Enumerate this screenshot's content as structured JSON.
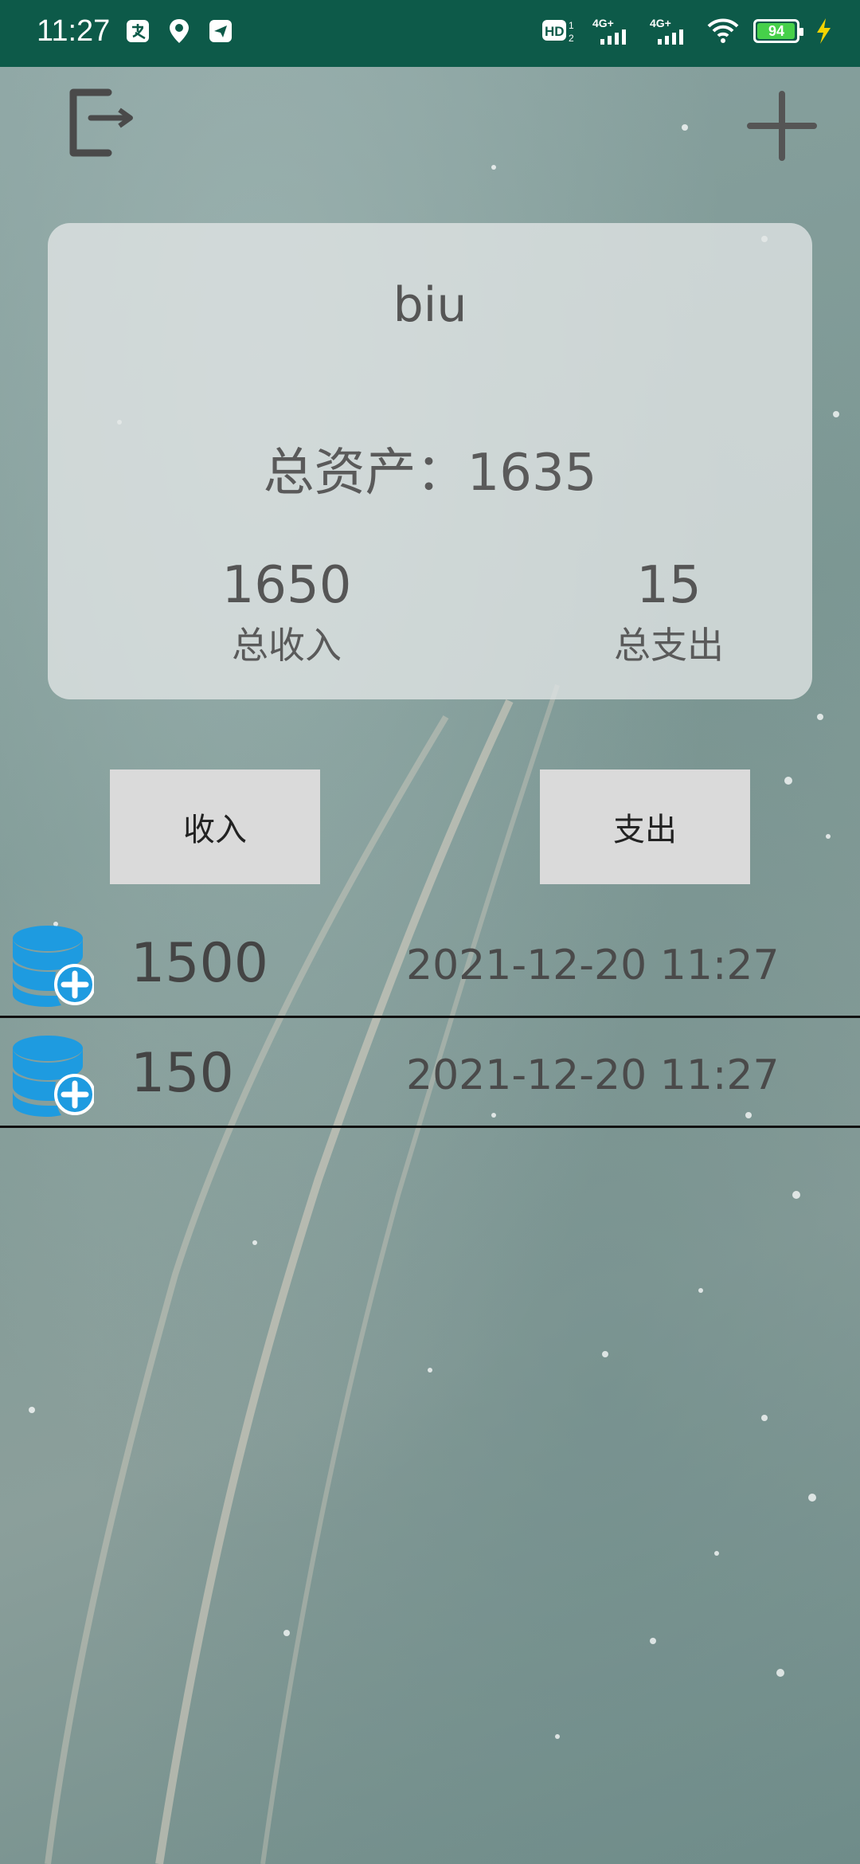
{
  "status_bar": {
    "time": "11:27",
    "left_icons": [
      "alipay-icon",
      "location-du-icon",
      "send-icon"
    ],
    "right_icons": [
      "hd-icon",
      "signal-4g-icon",
      "signal-4g-icon",
      "wifi-icon",
      "battery-icon",
      "charging-icon"
    ],
    "battery_level": "94",
    "hd_label": "HD",
    "hd_sub": "1",
    "hd_sub2": "2",
    "net1": "4G+",
    "net2": "4G+"
  },
  "header": {
    "logout_icon": "logout-icon",
    "add_icon": "plus-icon"
  },
  "summary": {
    "username": "biu",
    "total_assets_label": "总资产：",
    "total_assets_value": "1635",
    "total_income_value": "1650",
    "total_income_label": "总收入",
    "total_expense_value": "15",
    "total_expense_label": "总支出"
  },
  "buttons": {
    "income_label": "收入",
    "expense_label": "支出"
  },
  "records": [
    {
      "icon": "database-add-icon",
      "amount": "1500",
      "time": "2021-12-20 11:27"
    },
    {
      "icon": "database-add-icon",
      "amount": "150",
      "time": "2021-12-20 11:27"
    }
  ],
  "colors": {
    "status_bar_bg": "#0d5a49",
    "card_bg": "#e1e6e6",
    "button_bg": "#dadada",
    "record_icon": "#1e9be0"
  }
}
